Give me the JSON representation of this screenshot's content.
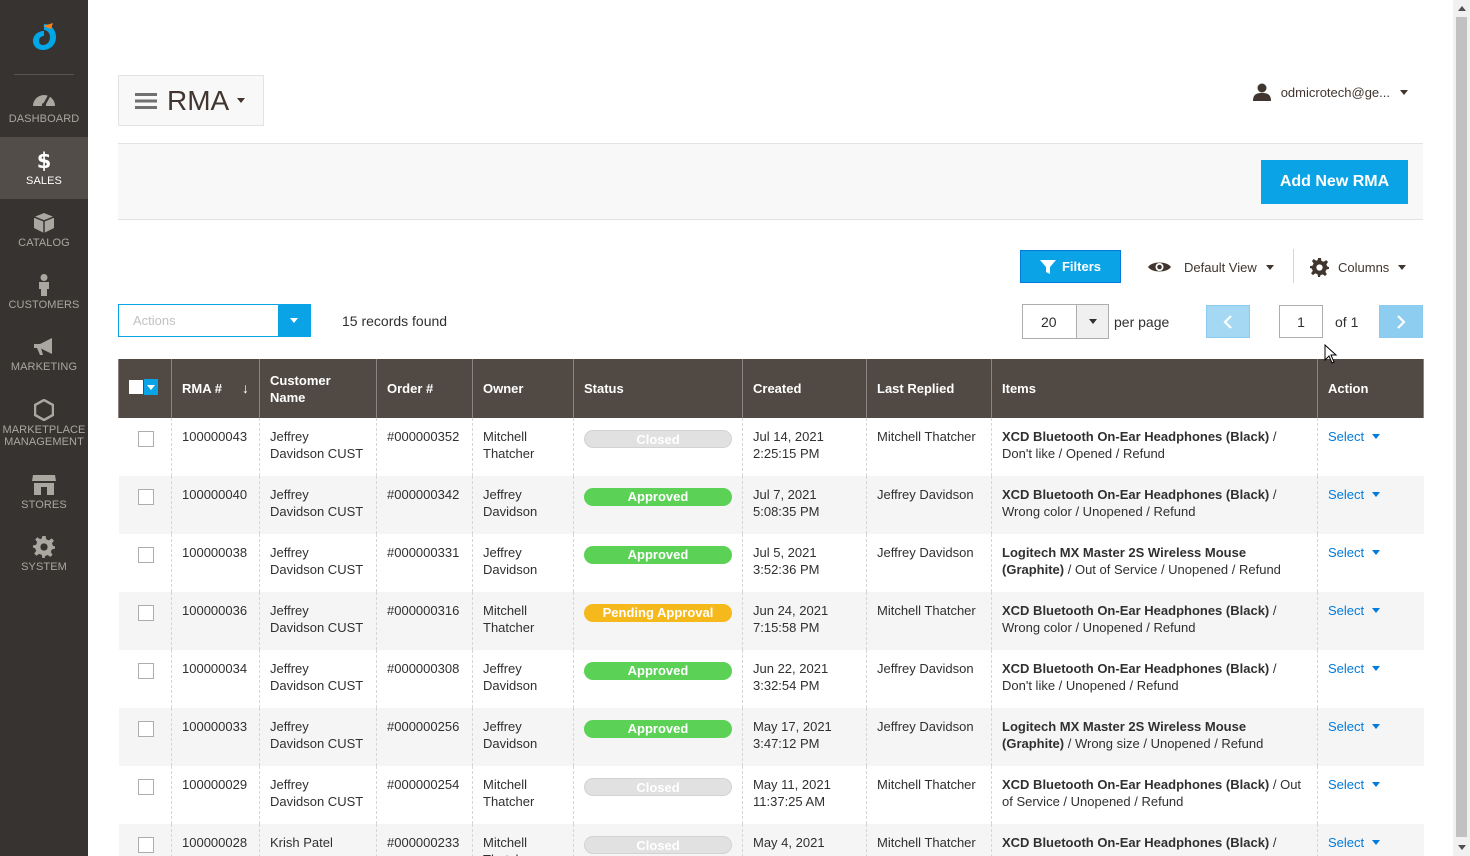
{
  "sidebar": {
    "items": [
      {
        "label": "Dashboard",
        "icon": "speedometer-icon"
      },
      {
        "label": "Sales",
        "icon": "dollar-icon",
        "active": true
      },
      {
        "label": "Catalog",
        "icon": "box-icon"
      },
      {
        "label": "Customers",
        "icon": "person-icon"
      },
      {
        "label": "Marketing",
        "icon": "megaphone-icon"
      },
      {
        "label": "Marketplace Management",
        "icon": "hexagon-icon"
      },
      {
        "label": "Stores",
        "icon": "storefront-icon"
      },
      {
        "label": "System",
        "icon": "gear-icon"
      }
    ]
  },
  "header": {
    "title": "RMA",
    "user": "odmicrotech@ge..."
  },
  "toolbar": {
    "add_label": "Add New RMA",
    "filters_label": "Filters",
    "view_label": "Default View",
    "columns_label": "Columns",
    "actions_placeholder": "Actions",
    "records_found": "15 records found",
    "per_page_value": "20",
    "per_page_label": "per page",
    "page_value": "1",
    "of_label": "of 1"
  },
  "colors": {
    "sidebar_bg": "#373330",
    "accent": "#0aa3e6",
    "header_bg": "#514943",
    "approved": "#5bd255",
    "pending": "#f5b91c",
    "closed": "#e1e1e1"
  },
  "table": {
    "columns": [
      "RMA #",
      "Customer Name",
      "Order #",
      "Owner",
      "Status",
      "Created",
      "Last Replied",
      "Items",
      "Action"
    ],
    "rows": [
      {
        "rma": "100000043",
        "customer": "Jeffrey Davidson CUST",
        "order": "#000000352",
        "owner": "Mitchell Thatcher",
        "status": "Closed",
        "status_type": "closed",
        "created_date": "Jul 14, 2021",
        "created_time": "2:25:15 PM",
        "last_replied": "Mitchell Thatcher",
        "item_name": "XCD Bluetooth On-Ear Headphones (Black)",
        "item_detail": " / Don't like / Opened / Refund",
        "action": "Select"
      },
      {
        "rma": "100000040",
        "customer": "Jeffrey Davidson CUST",
        "order": "#000000342",
        "owner": "Jeffrey Davidson",
        "status": "Approved",
        "status_type": "approved",
        "created_date": "Jul 7, 2021",
        "created_time": "5:08:35 PM",
        "last_replied": "Jeffrey Davidson",
        "item_name": "XCD Bluetooth On-Ear Headphones (Black)",
        "item_detail": " / Wrong color / Unopened / Refund",
        "action": "Select"
      },
      {
        "rma": "100000038",
        "customer": "Jeffrey Davidson CUST",
        "order": "#000000331",
        "owner": "Jeffrey Davidson",
        "status": "Approved",
        "status_type": "approved",
        "created_date": "Jul 5, 2021",
        "created_time": "3:52:36 PM",
        "last_replied": "Jeffrey Davidson",
        "item_name": "Logitech MX Master 2S Wireless Mouse (Graphite)",
        "item_detail": " / Out of Service / Unopened / Refund",
        "action": "Select"
      },
      {
        "rma": "100000036",
        "customer": "Jeffrey Davidson CUST",
        "order": "#000000316",
        "owner": "Mitchell Thatcher",
        "status": "Pending Approval",
        "status_type": "pending",
        "created_date": "Jun 24, 2021",
        "created_time": "7:15:58 PM",
        "last_replied": "Mitchell Thatcher",
        "item_name": "XCD Bluetooth On-Ear Headphones (Black)",
        "item_detail": " / Wrong color / Unopened / Refund",
        "action": "Select"
      },
      {
        "rma": "100000034",
        "customer": "Jeffrey Davidson CUST",
        "order": "#000000308",
        "owner": "Jeffrey Davidson",
        "status": "Approved",
        "status_type": "approved",
        "created_date": "Jun 22, 2021",
        "created_time": "3:32:54 PM",
        "last_replied": "Jeffrey Davidson",
        "item_name": "XCD Bluetooth On-Ear Headphones (Black)",
        "item_detail": " / Don't like / Unopened / Refund",
        "action": "Select"
      },
      {
        "rma": "100000033",
        "customer": "Jeffrey Davidson CUST",
        "order": "#000000256",
        "owner": "Jeffrey Davidson",
        "status": "Approved",
        "status_type": "approved",
        "created_date": "May 17, 2021",
        "created_time": "3:47:12 PM",
        "last_replied": "Jeffrey Davidson",
        "item_name": "Logitech MX Master 2S Wireless Mouse (Graphite)",
        "item_detail": " / Wrong size / Unopened / Refund",
        "action": "Select"
      },
      {
        "rma": "100000029",
        "customer": "Jeffrey Davidson CUST",
        "order": "#000000254",
        "owner": "Mitchell Thatcher",
        "status": "Closed",
        "status_type": "closed",
        "created_date": "May 11, 2021",
        "created_time": "11:37:25 AM",
        "last_replied": "Mitchell Thatcher",
        "item_name": "XCD Bluetooth On-Ear Headphones (Black)",
        "item_detail": " / Out of Service / Unopened / Refund",
        "action": "Select"
      },
      {
        "rma": "100000028",
        "customer": "Krish Patel",
        "order": "#000000233",
        "owner": "Mitchell Thatcher",
        "status": "Closed",
        "status_type": "closed",
        "created_date": "May 4, 2021",
        "created_time": "",
        "last_replied": "Mitchell Thatcher",
        "item_name": "XCD Bluetooth On-Ear Headphones (Black)",
        "item_detail": " /",
        "action": "Select"
      }
    ]
  }
}
